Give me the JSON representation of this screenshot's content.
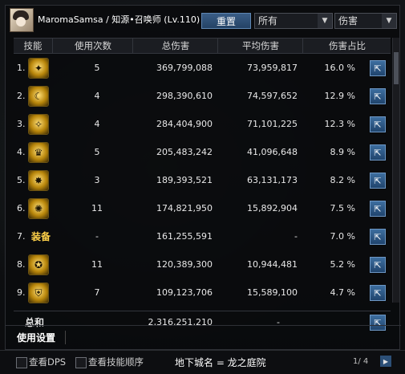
{
  "header": {
    "title": "MaromaSamsa / 知源•召唤师 (Lv.110)",
    "reset_label": "重置",
    "filter_select": "所有",
    "metric_select": "伤害"
  },
  "columns": [
    "技能",
    "使用次数",
    "总伤害",
    "平均伤害",
    "伤害占比"
  ],
  "rows": [
    {
      "rank": "1.",
      "icon": "skill-icon-1",
      "label": "",
      "count": "5",
      "total": "369,799,088",
      "avg": "73,959,817",
      "pct": "16.0 %"
    },
    {
      "rank": "2.",
      "icon": "skill-icon-2",
      "label": "",
      "count": "4",
      "total": "298,390,610",
      "avg": "74,597,652",
      "pct": "12.9 %"
    },
    {
      "rank": "3.",
      "icon": "skill-icon-3",
      "label": "",
      "count": "4",
      "total": "284,404,900",
      "avg": "71,101,225",
      "pct": "12.3 %"
    },
    {
      "rank": "4.",
      "icon": "skill-icon-4",
      "label": "",
      "count": "5",
      "total": "205,483,242",
      "avg": "41,096,648",
      "pct": "8.9 %"
    },
    {
      "rank": "5.",
      "icon": "skill-icon-5",
      "label": "",
      "count": "3",
      "total": "189,393,521",
      "avg": "63,131,173",
      "pct": "8.2 %"
    },
    {
      "rank": "6.",
      "icon": "skill-icon-6",
      "label": "",
      "count": "11",
      "total": "174,821,950",
      "avg": "15,892,904",
      "pct": "7.5 %"
    },
    {
      "rank": "7.",
      "icon": "",
      "label": "装备",
      "count": "-",
      "total": "161,255,591",
      "avg": "-",
      "pct": "7.0 %"
    },
    {
      "rank": "8.",
      "icon": "skill-icon-8",
      "label": "",
      "count": "11",
      "total": "120,389,300",
      "avg": "10,944,481",
      "pct": "5.2 %"
    },
    {
      "rank": "9.",
      "icon": "skill-icon-9",
      "label": "",
      "count": "7",
      "total": "109,123,706",
      "avg": "15,589,100",
      "pct": "4.7 %"
    }
  ],
  "summary": {
    "label": "总和",
    "total": "2,316,251,210",
    "avg": "-"
  },
  "footer": {
    "use_settings": "使用设置"
  },
  "bottom": {
    "check_dps": "查看DPS",
    "check_order": "查看技能顺序",
    "dungeon": "地下城名 = 龙之庭院",
    "page": "1/ 4"
  }
}
